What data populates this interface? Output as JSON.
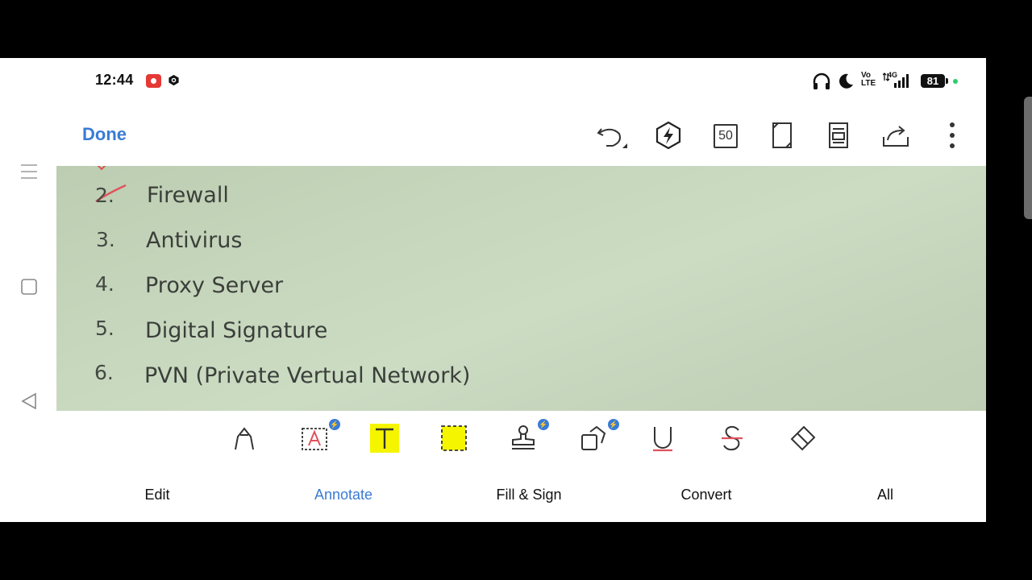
{
  "status_bar": {
    "time": "12:44",
    "network_label_top": "Vo",
    "network_label_bottom": "LTE",
    "signal_label": "4G",
    "battery": "81",
    "icons": [
      "screen-record-icon",
      "app-notification-icon",
      "headphones-icon",
      "do-not-disturb-moon-icon",
      "volte-icon",
      "signal-icon",
      "battery-icon",
      "charging-dot-icon"
    ]
  },
  "toolbar": {
    "done_label": "Done",
    "page_count": "50",
    "icons": [
      "undo-icon",
      "bolt-icon",
      "page-count-icon",
      "fullscreen-icon",
      "reader-view-icon",
      "share-icon",
      "more-options-icon"
    ]
  },
  "sidebar": {
    "icons": [
      "menu-icon",
      "home-square-icon",
      "back-triangle-icon"
    ]
  },
  "document": {
    "items": [
      {
        "number": "2.",
        "text": "Firewall"
      },
      {
        "number": "3.",
        "text": "Antivirus"
      },
      {
        "number": "4.",
        "text": "Proxy Server"
      },
      {
        "number": "5.",
        "text": "Digital Signature"
      },
      {
        "number": "6.",
        "text": "PVN (Private Vertual Network)"
      }
    ]
  },
  "annotate_tools": {
    "icons": [
      "pen-icon",
      "text-box-icon",
      "highlight-text-icon",
      "area-highlight-icon",
      "stamp-icon",
      "shapes-icon",
      "underline-icon",
      "strikethrough-icon",
      "eraser-icon"
    ],
    "accent_color": "#3a7bd5",
    "highlight_color": "#f5f500"
  },
  "bottom_tabs": [
    {
      "label": "Edit"
    },
    {
      "label": "Annotate"
    },
    {
      "label": "Fill & Sign"
    },
    {
      "label": "Convert"
    },
    {
      "label": "All"
    }
  ]
}
